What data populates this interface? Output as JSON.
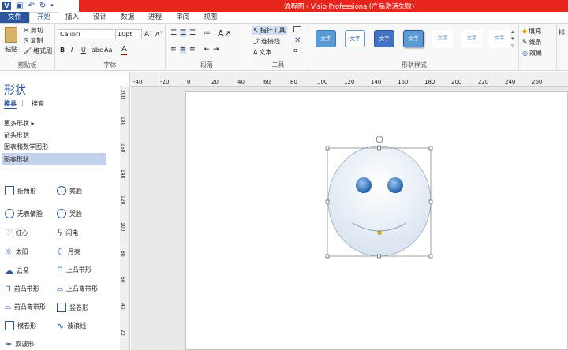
{
  "window": {
    "title": "流程图 - Visio Professional(产品激活失败)"
  },
  "tabs": [
    "文件",
    "开始",
    "插入",
    "设计",
    "数据",
    "进程",
    "审阅",
    "视图"
  ],
  "ribbon": {
    "clipboard": {
      "paste": "粘贴",
      "cut": "剪切",
      "copy": "复制",
      "format_painter": "格式刷",
      "label": "剪贴板"
    },
    "font": {
      "font_name": "Calibri",
      "font_size": "10pt",
      "label": "字体",
      "bold": "B",
      "italic": "I",
      "underline": "U",
      "strike": "abc",
      "aa": "Aa",
      "fontcolor": "A"
    },
    "paragraph": {
      "label": "段落"
    },
    "tools": {
      "pointer": "指针工具",
      "connector": "连接线",
      "text": "文本",
      "label": "工具"
    },
    "shape_styles": {
      "sample": "文字",
      "label": "形状样式"
    },
    "format": {
      "fill": "填充",
      "line": "线条",
      "effects": "效果"
    },
    "arrange": {
      "label": "排"
    }
  },
  "left_panel": {
    "title": "形状",
    "tab_stencils": "模具",
    "tab_search": "搜索",
    "categories": [
      "更多形状",
      "箭头形状",
      "图表和数学图形",
      "图案形状"
    ],
    "selected_category": "图案形状",
    "shapes": [
      [
        "折角形",
        "笑脸"
      ],
      [
        "无表情脸",
        "哭脸"
      ],
      [
        "红心",
        "闪电"
      ],
      [
        "太阳",
        "月亮"
      ],
      [
        "云朵",
        "上凸带形"
      ],
      [
        "前凸带形",
        "上凸弯带形"
      ],
      [
        "前凸弯带形",
        "竖卷形"
      ],
      [
        "横卷形",
        "波浪线"
      ],
      [
        "双波形",
        ""
      ]
    ]
  },
  "ruler_top": [
    "-40",
    "-20",
    "0",
    "20",
    "40",
    "60",
    "80",
    "100",
    "120",
    "140",
    "160",
    "180",
    "200",
    "220",
    "240",
    "260"
  ],
  "ruler_left": [
    "200",
    "180",
    "160",
    "140",
    "120",
    "100",
    "80",
    "60",
    "40",
    "20"
  ]
}
